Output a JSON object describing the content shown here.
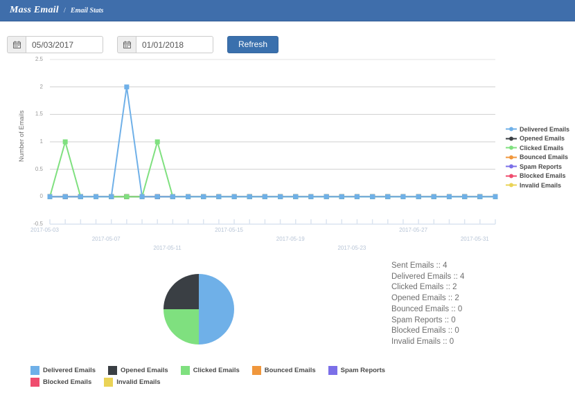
{
  "header": {
    "brand": "Mass Email",
    "separator": "/",
    "breadcrumb": "Email Stats"
  },
  "toolbar": {
    "start_date_value": "05/03/2017",
    "start_date_placeholder": "mm/dd/yyyy",
    "end_date_value": "01/01/2018",
    "end_date_placeholder": "mm/dd/yyyy",
    "refresh_label": "Refresh",
    "calendar_icon": "calendar-icon"
  },
  "colors": {
    "header_bg": "#3f6eab",
    "primary_button": "#3a70ad",
    "delivered": "#6fb0e8",
    "opened": "#3a3f44",
    "clicked": "#7fe07f",
    "bounced": "#f0973c",
    "spam": "#7b6fe8",
    "blocked": "#ef4c6e",
    "invalid": "#ead356",
    "gridline": "#cccccc",
    "axis": "#dbe4f0"
  },
  "chart_data": [
    {
      "type": "line",
      "title": "",
      "xlabel": "",
      "ylabel": "Number of Emails",
      "ylim": [
        -0.5,
        2.5
      ],
      "yticks": [
        "2.5",
        "2",
        "1.5",
        "1",
        "0.5",
        "0",
        "-0.5"
      ],
      "grid": true,
      "legend_position": "right",
      "x": [
        "2017-05-03",
        "2017-05-04",
        "2017-05-05",
        "2017-05-06",
        "2017-05-07",
        "2017-05-08",
        "2017-05-09",
        "2017-05-10",
        "2017-05-11",
        "2017-05-12",
        "2017-05-13",
        "2017-05-14",
        "2017-05-15",
        "2017-05-16",
        "2017-05-17",
        "2017-05-18",
        "2017-05-19",
        "2017-05-20",
        "2017-05-21",
        "2017-05-22",
        "2017-05-23",
        "2017-05-24",
        "2017-05-25",
        "2017-05-26",
        "2017-05-27",
        "2017-05-28",
        "2017-05-29",
        "2017-05-30",
        "2017-05-31",
        "2017-06-01"
      ],
      "xtick_labels": [
        "2017-05-03",
        "2017-05-07",
        "2017-05-11",
        "2017-05-15",
        "2017-05-19",
        "2017-05-23",
        "2017-05-27",
        "2017-05-31"
      ],
      "series": [
        {
          "name": "Delivered Emails",
          "color": "#6fb0e8",
          "values": [
            0,
            0,
            0,
            0,
            0,
            2,
            0,
            0,
            0,
            0,
            0,
            0,
            0,
            0,
            0,
            0,
            0,
            0,
            0,
            0,
            0,
            0,
            0,
            0,
            0,
            0,
            0,
            0,
            0,
            0
          ]
        },
        {
          "name": "Opened Emails",
          "color": "#3a3f44",
          "values": [
            0,
            0,
            0,
            0,
            0,
            0,
            0,
            0,
            0,
            0,
            0,
            0,
            0,
            0,
            0,
            0,
            0,
            0,
            0,
            0,
            0,
            0,
            0,
            0,
            0,
            0,
            0,
            0,
            0,
            0
          ]
        },
        {
          "name": "Clicked Emails",
          "color": "#7fe07f",
          "values": [
            0,
            1,
            0,
            0,
            0,
            0,
            0,
            1,
            0,
            0,
            0,
            0,
            0,
            0,
            0,
            0,
            0,
            0,
            0,
            0,
            0,
            0,
            0,
            0,
            0,
            0,
            0,
            0,
            0,
            0
          ]
        },
        {
          "name": "Bounced Emails",
          "color": "#f0973c",
          "values": [
            0,
            0,
            0,
            0,
            0,
            0,
            0,
            0,
            0,
            0,
            0,
            0,
            0,
            0,
            0,
            0,
            0,
            0,
            0,
            0,
            0,
            0,
            0,
            0,
            0,
            0,
            0,
            0,
            0,
            0
          ]
        },
        {
          "name": "Spam Reports",
          "color": "#7b6fe8",
          "values": [
            0,
            0,
            0,
            0,
            0,
            0,
            0,
            0,
            0,
            0,
            0,
            0,
            0,
            0,
            0,
            0,
            0,
            0,
            0,
            0,
            0,
            0,
            0,
            0,
            0,
            0,
            0,
            0,
            0,
            0
          ]
        },
        {
          "name": "Blocked Emails",
          "color": "#ef4c6e",
          "values": [
            0,
            0,
            0,
            0,
            0,
            0,
            0,
            0,
            0,
            0,
            0,
            0,
            0,
            0,
            0,
            0,
            0,
            0,
            0,
            0,
            0,
            0,
            0,
            0,
            0,
            0,
            0,
            0,
            0,
            0
          ]
        },
        {
          "name": "Invalid Emails",
          "color": "#ead356",
          "values": [
            0,
            0,
            0,
            0,
            0,
            0,
            0,
            0,
            0,
            0,
            0,
            0,
            0,
            0,
            0,
            0,
            0,
            0,
            0,
            0,
            0,
            0,
            0,
            0,
            0,
            0,
            0,
            0,
            0,
            0
          ]
        }
      ]
    },
    {
      "type": "pie",
      "title": "",
      "legend_position": "bottom",
      "labels": [
        "Delivered Emails",
        "Opened Emails",
        "Clicked Emails",
        "Bounced Emails",
        "Spam Reports",
        "Blocked Emails",
        "Invalid Emails"
      ],
      "values": [
        4,
        2,
        2,
        0,
        0,
        0,
        0
      ],
      "colors": [
        "#6fb0e8",
        "#3a3f44",
        "#7fe07f",
        "#f0973c",
        "#7b6fe8",
        "#ef4c6e",
        "#ead356"
      ],
      "slices": [
        {
          "label": "Delivered Emails",
          "value": 4,
          "percent": 50,
          "color": "#6fb0e8"
        },
        {
          "label": "Clicked Emails",
          "value": 2,
          "percent": 25,
          "color": "#7fe07f"
        },
        {
          "label": "Opened Emails",
          "value": 2,
          "percent": 25,
          "color": "#3a3f44"
        }
      ]
    }
  ],
  "stats": [
    "Sent Emails :: 4",
    "Delivered Emails :: 4",
    "Clicked Emails :: 2",
    "Opened Emails :: 2",
    "Bounced Emails :: 0",
    "Spam Reports :: 0",
    "Blocked Emails :: 0",
    "Invalid Emails :: 0"
  ]
}
